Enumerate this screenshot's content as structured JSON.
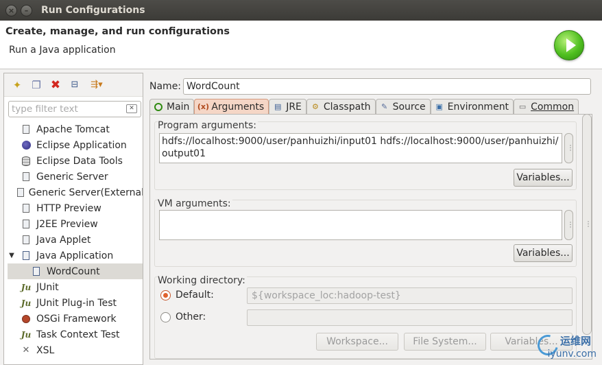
{
  "window": {
    "title": "Run Configurations"
  },
  "header": {
    "title": "Create, manage, and run configurations",
    "subtitle": "Run a Java application"
  },
  "left": {
    "filter_placeholder": "type filter text",
    "tree": [
      {
        "label": "Apache Tomcat",
        "icon": "tomcat-icon"
      },
      {
        "label": "Eclipse Application",
        "icon": "eclipse-icon"
      },
      {
        "label": "Eclipse Data Tools",
        "icon": "database-icon"
      },
      {
        "label": "Generic Server",
        "icon": "server-icon"
      },
      {
        "label": "Generic Server(External",
        "icon": "server-icon"
      },
      {
        "label": "HTTP Preview",
        "icon": "server-icon"
      },
      {
        "label": "J2EE Preview",
        "icon": "server-icon"
      },
      {
        "label": "Java Applet",
        "icon": "applet-icon"
      },
      {
        "label": "Java Application",
        "icon": "java-app-icon",
        "expanded": true
      },
      {
        "label": "WordCount",
        "icon": "java-app-icon",
        "child": true,
        "selected": true
      },
      {
        "label": "JUnit",
        "icon": "junit-icon"
      },
      {
        "label": "JUnit Plug-in Test",
        "icon": "junit-icon"
      },
      {
        "label": "OSGi Framework",
        "icon": "osgi-icon"
      },
      {
        "label": "Task Context Test",
        "icon": "junit-icon"
      },
      {
        "label": "XSL",
        "icon": "xsl-icon"
      }
    ]
  },
  "main": {
    "name_label": "Name:",
    "name_value": "WordCount",
    "tabs": [
      {
        "label": "Main",
        "icon": "main-tab-icon"
      },
      {
        "label": "Arguments",
        "icon": "arguments-tab-icon",
        "active": true
      },
      {
        "label": "JRE",
        "icon": "jre-tab-icon"
      },
      {
        "label": "Classpath",
        "icon": "classpath-tab-icon"
      },
      {
        "label": "Source",
        "icon": "source-tab-icon"
      },
      {
        "label": "Environment",
        "icon": "environment-tab-icon"
      },
      {
        "label": "Common",
        "icon": "common-tab-icon"
      }
    ],
    "program_args": {
      "label": "Program arguments:",
      "value": "hdfs://localhost:9000/user/panhuizhi/input01 hdfs://localhost:9000/user/panhuizhi/\noutput01",
      "variables_button": "Variables..."
    },
    "vm_args": {
      "label": "VM arguments:",
      "value": "",
      "variables_button": "Variables..."
    },
    "working_dir": {
      "label": "Working directory:",
      "default_label": "Default:",
      "default_value": "${workspace_loc:hadoop-test}",
      "other_label": "Other:",
      "other_value": "",
      "workspace_button": "Workspace...",
      "filesystem_button": "File System...",
      "variables_button": "Variables..."
    }
  },
  "watermark": {
    "cn": "运维网",
    "url": "iyunv.com"
  },
  "colors": {
    "active_tab": "#f5d6c6",
    "radio_accent": "#e0622e",
    "title_bar": "#3c3b37"
  }
}
